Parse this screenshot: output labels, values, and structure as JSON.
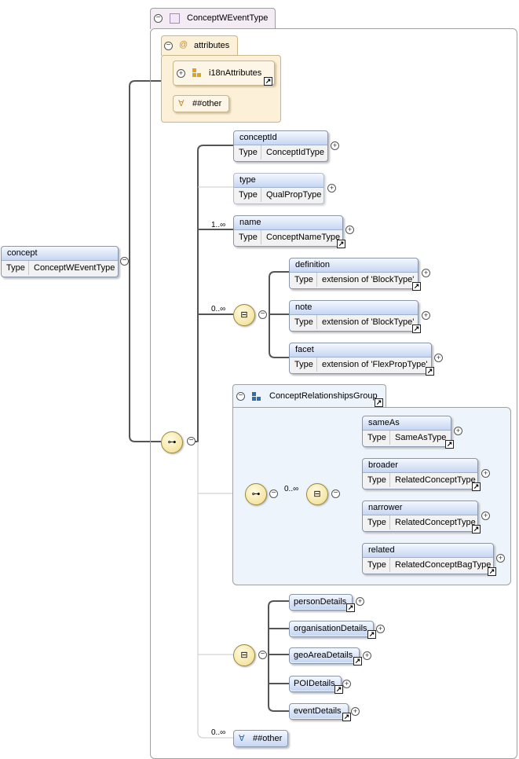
{
  "root": {
    "name": "concept",
    "type_label": "Type",
    "type_value": "ConceptWEventType"
  },
  "complex_type": {
    "title": "ConceptWEventType"
  },
  "attributes": {
    "title": "attributes",
    "group": "i18nAttributes",
    "any_attr": "##other"
  },
  "sequence_elements": [
    {
      "name": "conceptId",
      "type_label": "Type",
      "type_value": "ConceptIdType"
    },
    {
      "name": "type",
      "type_label": "Type",
      "type_value": "QualPropType"
    },
    {
      "name": "name",
      "type_label": "Type",
      "type_value": "ConceptNameType",
      "cardinality": "1..∞"
    }
  ],
  "choice1": {
    "cardinality": "0..∞",
    "items": [
      {
        "name": "definition",
        "type_label": "Type",
        "type_value": "extension of 'BlockType'"
      },
      {
        "name": "note",
        "type_label": "Type",
        "type_value": "extension of 'BlockType'"
      },
      {
        "name": "facet",
        "type_label": "Type",
        "type_value": "extension of 'FlexPropType'"
      }
    ]
  },
  "group": {
    "title": "ConceptRelationshipsGroup",
    "cardinality": "0..∞",
    "items": [
      {
        "name": "sameAs",
        "type_label": "Type",
        "type_value": "SameAsType"
      },
      {
        "name": "broader",
        "type_label": "Type",
        "type_value": "RelatedConceptType"
      },
      {
        "name": "narrower",
        "type_label": "Type",
        "type_value": "RelatedConceptType"
      },
      {
        "name": "related",
        "type_label": "Type",
        "type_value": "RelatedConceptBagType"
      }
    ]
  },
  "choice2": {
    "items": [
      "personDetails",
      "organisationDetails",
      "geoAreaDetails",
      "POIDetails",
      "eventDetails"
    ]
  },
  "any_element": {
    "cardinality": "0..∞",
    "label": "##other"
  },
  "colors": {
    "element_header": "#c6d6f2",
    "attribute_bg": "#fdf0d8",
    "group_bg": "#eef4fb",
    "compositor": "#f0dc8c"
  }
}
